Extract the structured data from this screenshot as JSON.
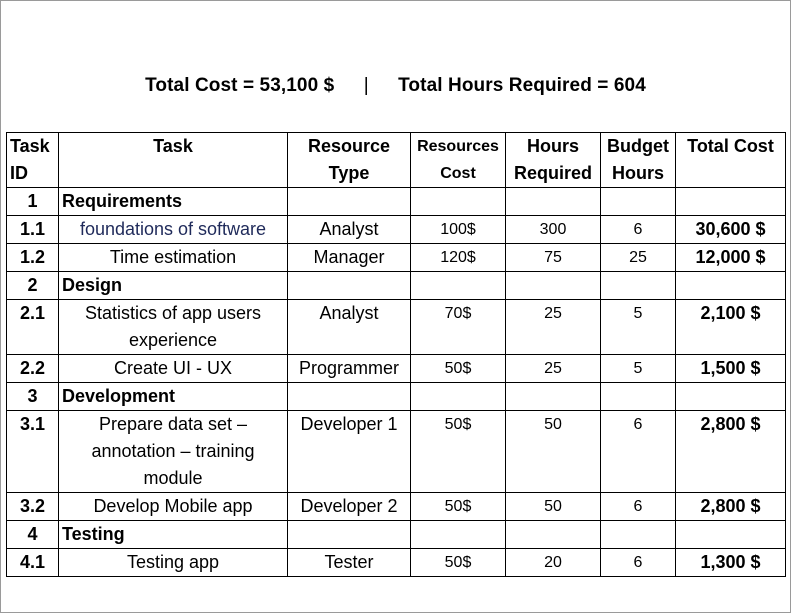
{
  "summary": {
    "total_cost": "Total Cost = 53,100 $",
    "separator": "|",
    "total_hours": "Total Hours Required = 604"
  },
  "headers": {
    "task_id": [
      "Task",
      "ID"
    ],
    "task": "Task",
    "resource_type": [
      "Resource",
      "Type"
    ],
    "resources_cost": [
      "Resources",
      "Cost"
    ],
    "hours_required": [
      "Hours",
      "Required"
    ],
    "budget_hours": [
      "Budget",
      "Hours"
    ],
    "total_cost": "Total Cost"
  },
  "rows": [
    {
      "kind": "phase",
      "id": "1",
      "task": "Requirements"
    },
    {
      "kind": "task",
      "id": "1.1",
      "task": "foundations of software",
      "resource": "Analyst",
      "cost": "100$",
      "hours": "300",
      "budget": "6",
      "total": "30,600 $"
    },
    {
      "kind": "task",
      "id": "1.2",
      "task": "Time estimation",
      "resource": "Manager",
      "cost": "120$",
      "hours": "75",
      "budget": "25",
      "total": "12,000 $"
    },
    {
      "kind": "phase",
      "id": "2",
      "task": "Design"
    },
    {
      "kind": "task",
      "id": "2.1",
      "task": "Statistics of app users experience",
      "resource": "Analyst",
      "cost": "70$",
      "hours": "25",
      "budget": "5",
      "total": "2,100 $"
    },
    {
      "kind": "task",
      "id": "2.2",
      "task": "Create UI - UX",
      "resource": "Programmer",
      "cost": "50$",
      "hours": "25",
      "budget": "5",
      "total": "1,500 $"
    },
    {
      "kind": "phase",
      "id": "3",
      "task": "Development"
    },
    {
      "kind": "task",
      "id": "3.1",
      "task": "Prepare data set – annotation – training module",
      "resource": "Developer 1",
      "cost": "50$",
      "hours": "50",
      "budget": "6",
      "total": "2,800 $"
    },
    {
      "kind": "task",
      "id": "3.2",
      "task": "Develop Mobile app",
      "resource": "Developer 2",
      "cost": "50$",
      "hours": "50",
      "budget": "6",
      "total": "2,800 $"
    },
    {
      "kind": "phase",
      "id": "4",
      "task": "Testing"
    },
    {
      "kind": "task",
      "id": "4.1",
      "task": "Testing app",
      "resource": "Tester",
      "cost": "50$",
      "hours": "20",
      "budget": "6",
      "total": "1,300 $"
    }
  ]
}
